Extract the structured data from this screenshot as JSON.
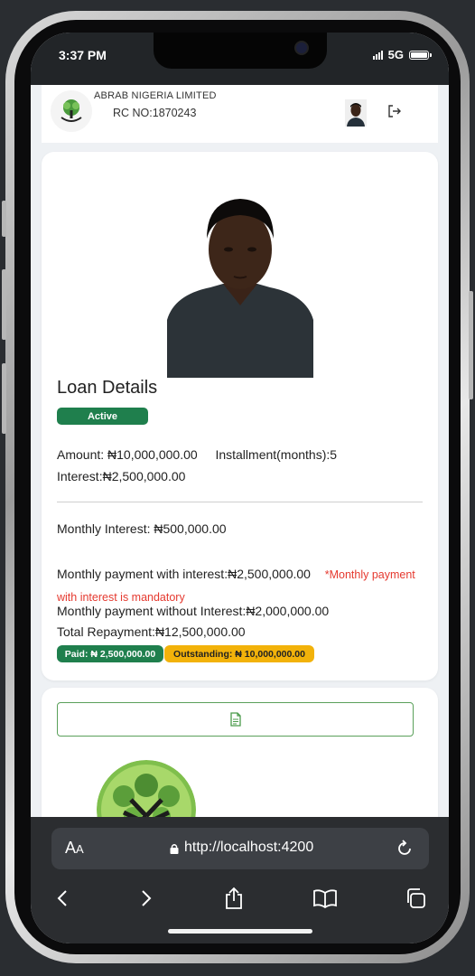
{
  "status_bar": {
    "time": "3:37 PM",
    "network": "5G"
  },
  "header": {
    "company_name": "ABRAB NIGERIA LIMITED",
    "rc_number": "RC NO:1870243",
    "logout_icon": "logout-icon"
  },
  "loan": {
    "title": "Loan Details",
    "status": "Active",
    "amount": "Amount: ₦10,000,000.00",
    "installment": "Installment(months):5",
    "interest": "Interest:₦2,500,000.00",
    "monthly_interest": "Monthly Interest: ₦500,000.00",
    "monthly_with_interest": "Monthly payment with interest:₦2,500,000.00",
    "mandatory_note": "*Monthly payment with interest is mandatory",
    "monthly_without_interest": "Monthly payment without Interest:₦2,000,000.00",
    "total_repayment": "Total Repayment:₦12,500,000.00",
    "paid": "Paid: ₦ 2,500,000.00",
    "outstanding": "Outstanding: ₦ 10,000,000.00"
  },
  "documents": {
    "button_icon": "document-icon"
  },
  "browser": {
    "text_size_label": "A",
    "text_size_label_small": "A",
    "url": "http://localhost:4200"
  },
  "colors": {
    "accent_green": "#1f7f4d",
    "warning_yellow": "#f2b20a",
    "error_red": "#e5392f"
  }
}
